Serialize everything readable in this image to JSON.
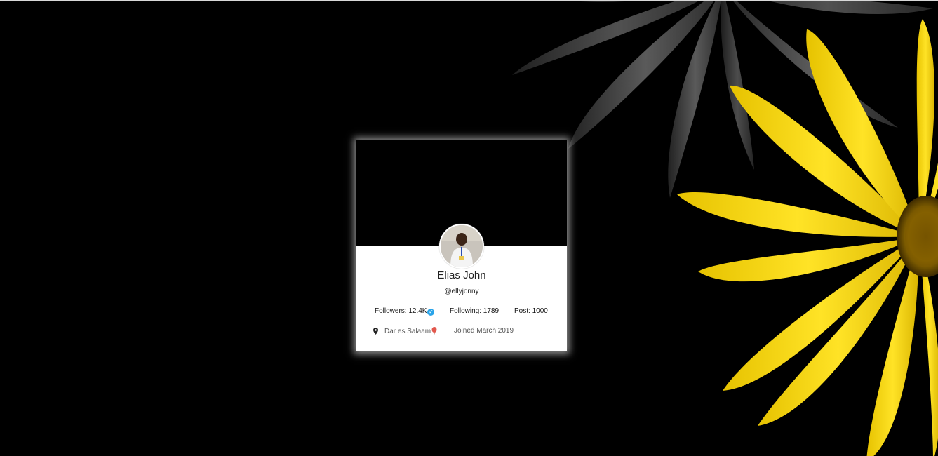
{
  "profile": {
    "name": "Elias John",
    "handle": "@ellyjonny",
    "followers_label": "Followers: 12.4K",
    "following_label": "Following: 1789",
    "posts_label": "Post: 1000",
    "location": "Dar es Salaam",
    "joined": "Joined March 2019"
  },
  "colors": {
    "background": "#000000",
    "card": "#ffffff",
    "verified": "#2aa4e9",
    "flower_yellow": "#f5d90a",
    "flower_gray": "#3a3a3a"
  },
  "icons": {
    "verified": "verified-badge-icon",
    "location": "map-pin-icon",
    "location_emoji": "balloon-icon"
  }
}
